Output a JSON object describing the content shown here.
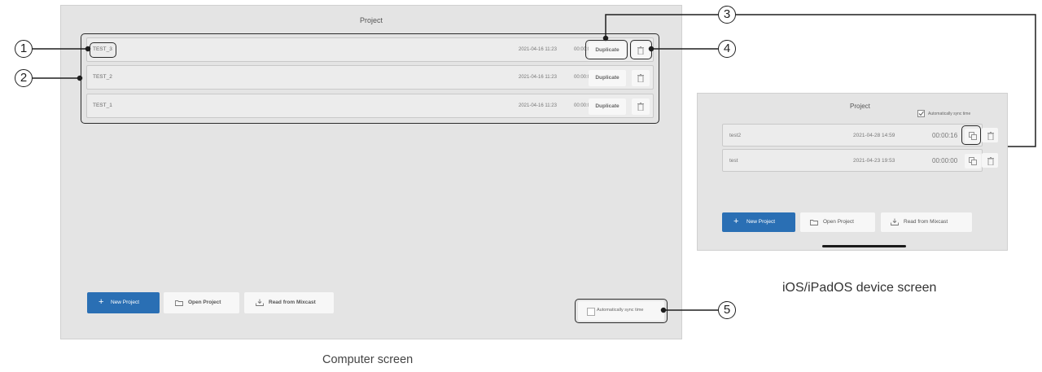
{
  "desktop": {
    "title": "Project",
    "projects": [
      {
        "name": "TEST_3",
        "date": "2021-04-16 11:23",
        "duration": "00:00:00",
        "duplicate_label": "Duplicate"
      },
      {
        "name": "TEST_2",
        "date": "2021-04-16 11:23",
        "duration": "00:00:00",
        "duplicate_label": "Duplicate"
      },
      {
        "name": "TEST_1",
        "date": "2021-04-16 11:23",
        "duration": "00:00:00",
        "duplicate_label": "Duplicate"
      }
    ],
    "buttons": {
      "new_project": "New Project",
      "open_project": "Open Project",
      "read_from_mixcast": "Read from Mixcast"
    },
    "sync_label": "Automatically sync time",
    "caption": "Computer screen"
  },
  "ios": {
    "title": "Project",
    "sync_label": "Automatically sync time",
    "projects": [
      {
        "name": "test2",
        "date": "2021-04-28 14:59",
        "duration": "00:00:16"
      },
      {
        "name": "test",
        "date": "2021-04-23 19:53",
        "duration": "00:00:00"
      }
    ],
    "buttons": {
      "new_project": "New Project",
      "open_project": "Open Project",
      "read_from_mixcast": "Read from Mixcast"
    },
    "caption": "iOS/iPadOS device screen"
  },
  "callouts": [
    "1",
    "2",
    "3",
    "4",
    "5"
  ],
  "colors": {
    "accent": "#2a6fb4",
    "panel": "#e4e4e4",
    "callout": "#1e1e1e"
  },
  "icons": [
    "plus-icon",
    "folder-icon",
    "download-tray-icon",
    "trash-icon",
    "duplicate-icon",
    "checkbox-icon"
  ]
}
